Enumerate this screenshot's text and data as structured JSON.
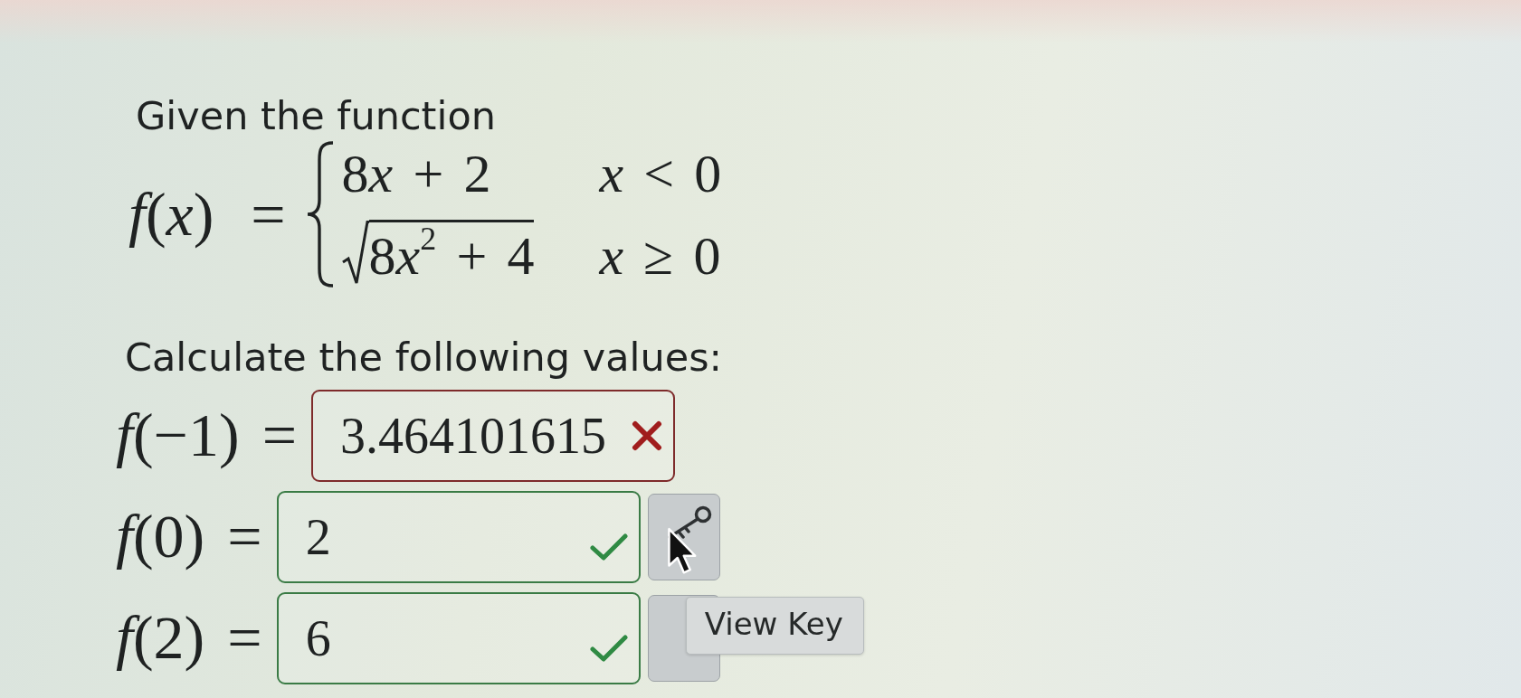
{
  "problem": {
    "intro": "Given the function",
    "function": {
      "name": "*f*(*x*) =",
      "cases": [
        {
          "kind": "plain",
          "expression": [
            "8",
            "*x* + 2"
          ],
          "condition": "*x* < 0"
        },
        {
          "kind": "root",
          "expression": [
            "8",
            "*x*$^{2}$ + 4"
          ],
          "condition": "*x* ≥ 0"
        }
      ]
    }
  },
  "instruction": "Calculate the following values:",
  "answers": [
    {
      "label": "*f*(−1) =",
      "value": "3.464101615",
      "correct": false
    },
    {
      "label": "*f*(0) =",
      "value": "2",
      "correct": true,
      "button": {
        "icon_visible": true,
        "hovered": true
      }
    },
    {
      "label": "*f*(2) =",
      "value": "6",
      "correct": true,
      "button": {
        "icon_visible": false,
        "hovered": false
      }
    }
  ],
  "tooltip": "View Key"
}
